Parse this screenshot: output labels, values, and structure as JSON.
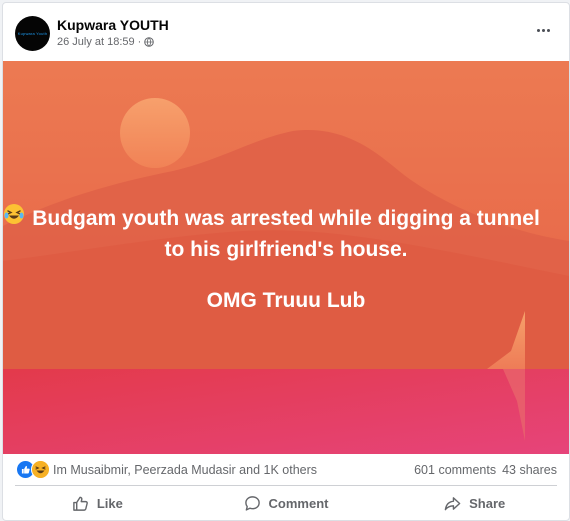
{
  "post": {
    "page_name": "Kupwara YOUTH",
    "avatar_logo_text": "Kupwara Youth",
    "timestamp": "26 July at 18:59",
    "separator": "·",
    "privacy_icon": "globe-icon",
    "more_icon": "ellipsis-icon",
    "text_line1": "Budgam youth was arrested while digging a tunnel to his girlfriend's house.",
    "text_line2": "OMG Truuu Lub",
    "emoji": "laughing-crying-emoji",
    "colors": {
      "bg_top": "#e8704f",
      "bg_mountain": "#d9543f",
      "sun": "#f48d62",
      "water": "#e8356b"
    }
  },
  "stats": {
    "reaction_icons": [
      "like-reaction-icon",
      "haha-reaction-icon"
    ],
    "reacted_by": "Im Musaibmir, Peerzada Mudasir and 1K others",
    "comments": "601 comments",
    "shares": "43 shares"
  },
  "actions": {
    "like": "Like",
    "comment": "Comment",
    "share": "Share"
  }
}
